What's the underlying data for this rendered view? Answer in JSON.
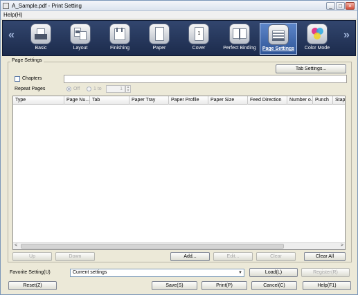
{
  "window": {
    "title": "A_Sample.pdf - Print Setting",
    "minimize": "_",
    "maximize": "□",
    "close": "×"
  },
  "menubar": {
    "help": "Help(H)"
  },
  "toolbar": {
    "left_arrow": "«",
    "right_arrow": "»",
    "items": [
      {
        "label": "Basic",
        "icon": "basic-icon"
      },
      {
        "label": "Layout",
        "icon": "layout-icon"
      },
      {
        "label": "Finishing",
        "icon": "finishing-icon"
      },
      {
        "label": "Paper",
        "icon": "paper-icon"
      },
      {
        "label": "Cover",
        "icon": "cover-icon"
      },
      {
        "label": "Perfect Binding",
        "icon": "perfect-binding-icon"
      },
      {
        "label": "Page Settings",
        "icon": "page-settings-icon",
        "active": true
      },
      {
        "label": "Color Mode",
        "icon": "color-mode-icon"
      }
    ]
  },
  "page_settings": {
    "group_title": "Page Settings",
    "tab_settings_button": "Tab Settings...",
    "chapters_label": "Chapters",
    "chapters_value": "",
    "repeat_pages_label": "Repeat Pages",
    "radio_off": "Off",
    "radio_1to": "1 to",
    "repeat_value": "1",
    "table": {
      "columns": [
        "Type",
        "Page Nu...",
        "Tab",
        "Paper Tray",
        "Paper Profile",
        "Paper Size",
        "Feed Direction",
        "Number o...",
        "Punch",
        "Stapl"
      ],
      "rows": []
    },
    "buttons": {
      "up": "Up",
      "down": "Down",
      "add": "Add...",
      "edit": "Edit...",
      "clear": "Clear",
      "clear_all": "Clear All"
    }
  },
  "favorite": {
    "label": "Favorite Setting(U)",
    "value": "Current settings",
    "load": "Load(L)",
    "register": "Register(R)"
  },
  "footer": {
    "reset": "Reset(Z)",
    "save": "Save(S)",
    "print": "Print(P)",
    "cancel": "Cancel(C)",
    "help": "Help(F1)"
  },
  "colors": {
    "toolbar_bg": "#1c2b4c",
    "active_item": "#2f5597",
    "dialog_bg": "#ece9d8"
  }
}
